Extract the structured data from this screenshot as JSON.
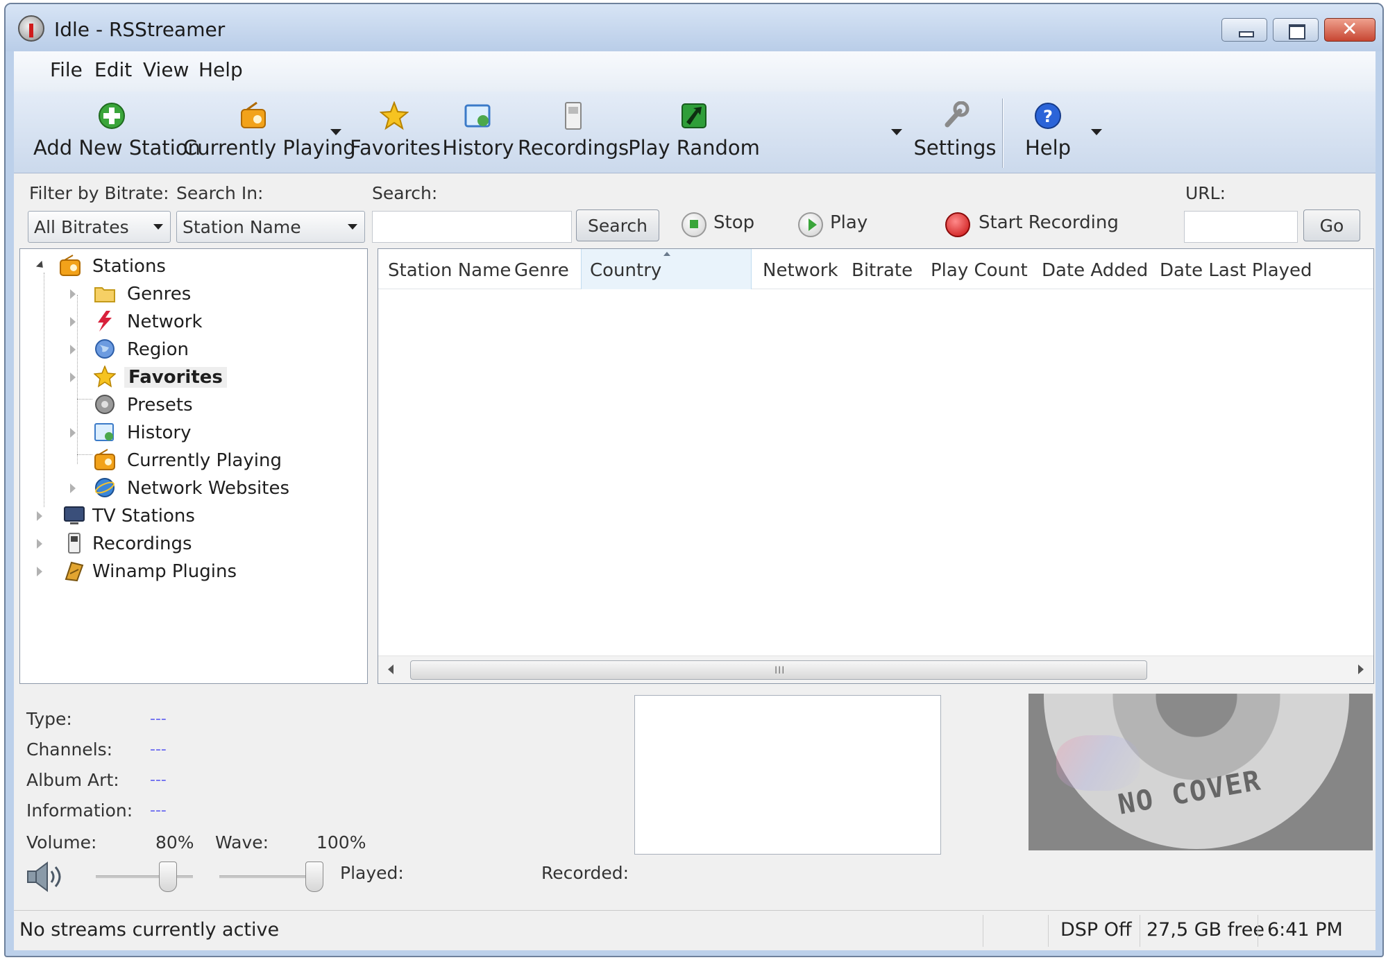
{
  "window": {
    "title": "Idle - RSStreamer"
  },
  "menu": [
    {
      "label": "File"
    },
    {
      "label": "Edit"
    },
    {
      "label": "View"
    },
    {
      "label": "Help"
    }
  ],
  "toolbar": {
    "add_new_station": "Add New Station",
    "currently_playing": "Currently Playing",
    "favorites": "Favorites",
    "history": "History",
    "recordings": "Recordings",
    "play_random": "Play Random",
    "settings": "Settings",
    "help": "Help"
  },
  "filters": {
    "bitrate_label": "Filter by Bitrate:",
    "bitrate_value": "All Bitrates",
    "search_in_label": "Search In:",
    "search_in_value": "Station Name",
    "search_label": "Search:",
    "search_value": "",
    "search_button": "Search",
    "stop": "Stop",
    "play": "Play",
    "start_recording": "Start Recording",
    "url_label": "URL:",
    "url_value": "",
    "go_button": "Go"
  },
  "tree": {
    "stations": "Stations",
    "children": [
      "Genres",
      "Network",
      "Region",
      "Favorites",
      "Presets",
      "History",
      "Currently Playing",
      "Network Websites"
    ],
    "top_level": [
      "TV Stations",
      "Recordings",
      "Winamp Plugins"
    ]
  },
  "list": {
    "columns": [
      "Station Name",
      "Genre",
      "Country",
      "Network",
      "Bitrate",
      "Play Count",
      "Date Added",
      "Date Last Played"
    ],
    "sorted_column": "Country",
    "scroll_grip": "III"
  },
  "info": {
    "type_label": "Type:",
    "type_value": "---",
    "channels_label": "Channels:",
    "channels_value": "---",
    "album_art_label": "Album Art:",
    "album_art_value": "---",
    "information_label": "Information:",
    "information_value": "---",
    "volume_label": "Volume:",
    "volume_value": "80%",
    "wave_label": "Wave:",
    "wave_value": "100%",
    "played_label": "Played:",
    "recorded_label": "Recorded:"
  },
  "levels": {
    "volume": 0.8,
    "wave": 1.0
  },
  "cover": {
    "text": "NO COVER"
  },
  "status": {
    "message": "No streams currently active",
    "dsp": "DSP Off",
    "free": "27,5 GB free",
    "time": "6:41 PM"
  },
  "colors": {
    "accent": "#6a6af0",
    "record_red": "#d01c1c",
    "titlebar": "#bcd0ea"
  }
}
